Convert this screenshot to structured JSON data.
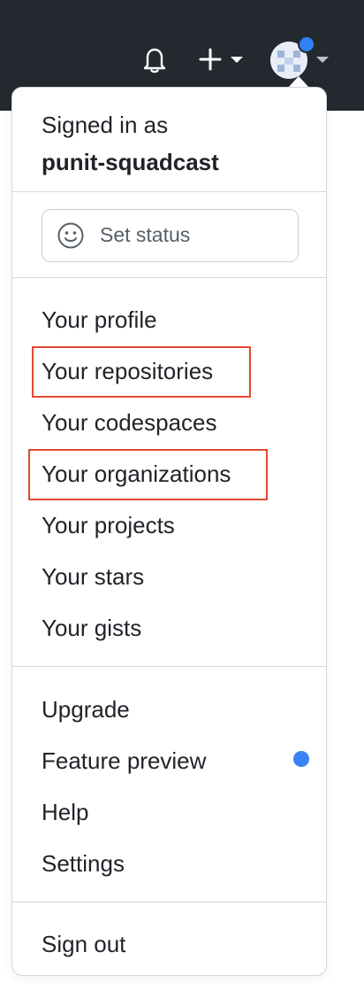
{
  "header": {
    "icons": [
      "bell-icon",
      "plus-icon",
      "avatar"
    ]
  },
  "account": {
    "signed_in_label": "Signed in as",
    "username": "punit-squadcast"
  },
  "status": {
    "label": "Set status",
    "icon": "smiley-icon"
  },
  "menu": {
    "group1": [
      "Your profile",
      "Your repositories",
      "Your codespaces",
      "Your organizations",
      "Your projects",
      "Your stars",
      "Your gists"
    ],
    "group2": [
      "Upgrade",
      "Feature preview",
      "Help",
      "Settings"
    ],
    "sign_out": "Sign out"
  },
  "highlighted_items": [
    "Your repositories",
    "Your organizations"
  ],
  "colors": {
    "header_bg": "#24292f",
    "accent_dot": "#2f81f7",
    "highlight_border": "#e04b2f",
    "text": "#1f2328"
  }
}
